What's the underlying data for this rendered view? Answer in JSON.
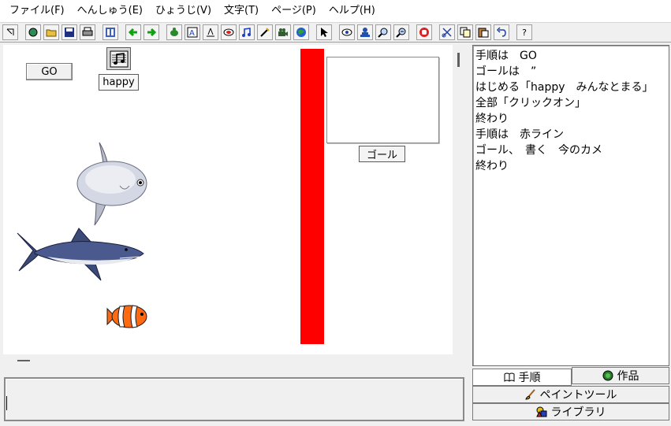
{
  "menu": [
    "ファイル(F)",
    "へんしゅう(E)",
    "ひょうじ(V)",
    "文字(T)",
    "ページ(P)",
    "ヘルプ(H)"
  ],
  "toolbar": {
    "help_label": "?"
  },
  "stage": {
    "go_button_label": "GO",
    "happy_label": "happy",
    "goal_label": "ゴール",
    "red_line_color": "#ff0000"
  },
  "script": {
    "lines": [
      "手順は　GO",
      "ゴールは　”",
      "はじめる「happy　みんなとまる」",
      "全部「クリックオン」",
      "終わり",
      "手順は　赤ライン",
      "ゴール、　書く　今のカメ",
      "終わり"
    ]
  },
  "tabs": {
    "procedure": "手順",
    "works": "作品",
    "paint_tool": "ペイントツール",
    "library": "ライブラリ"
  }
}
